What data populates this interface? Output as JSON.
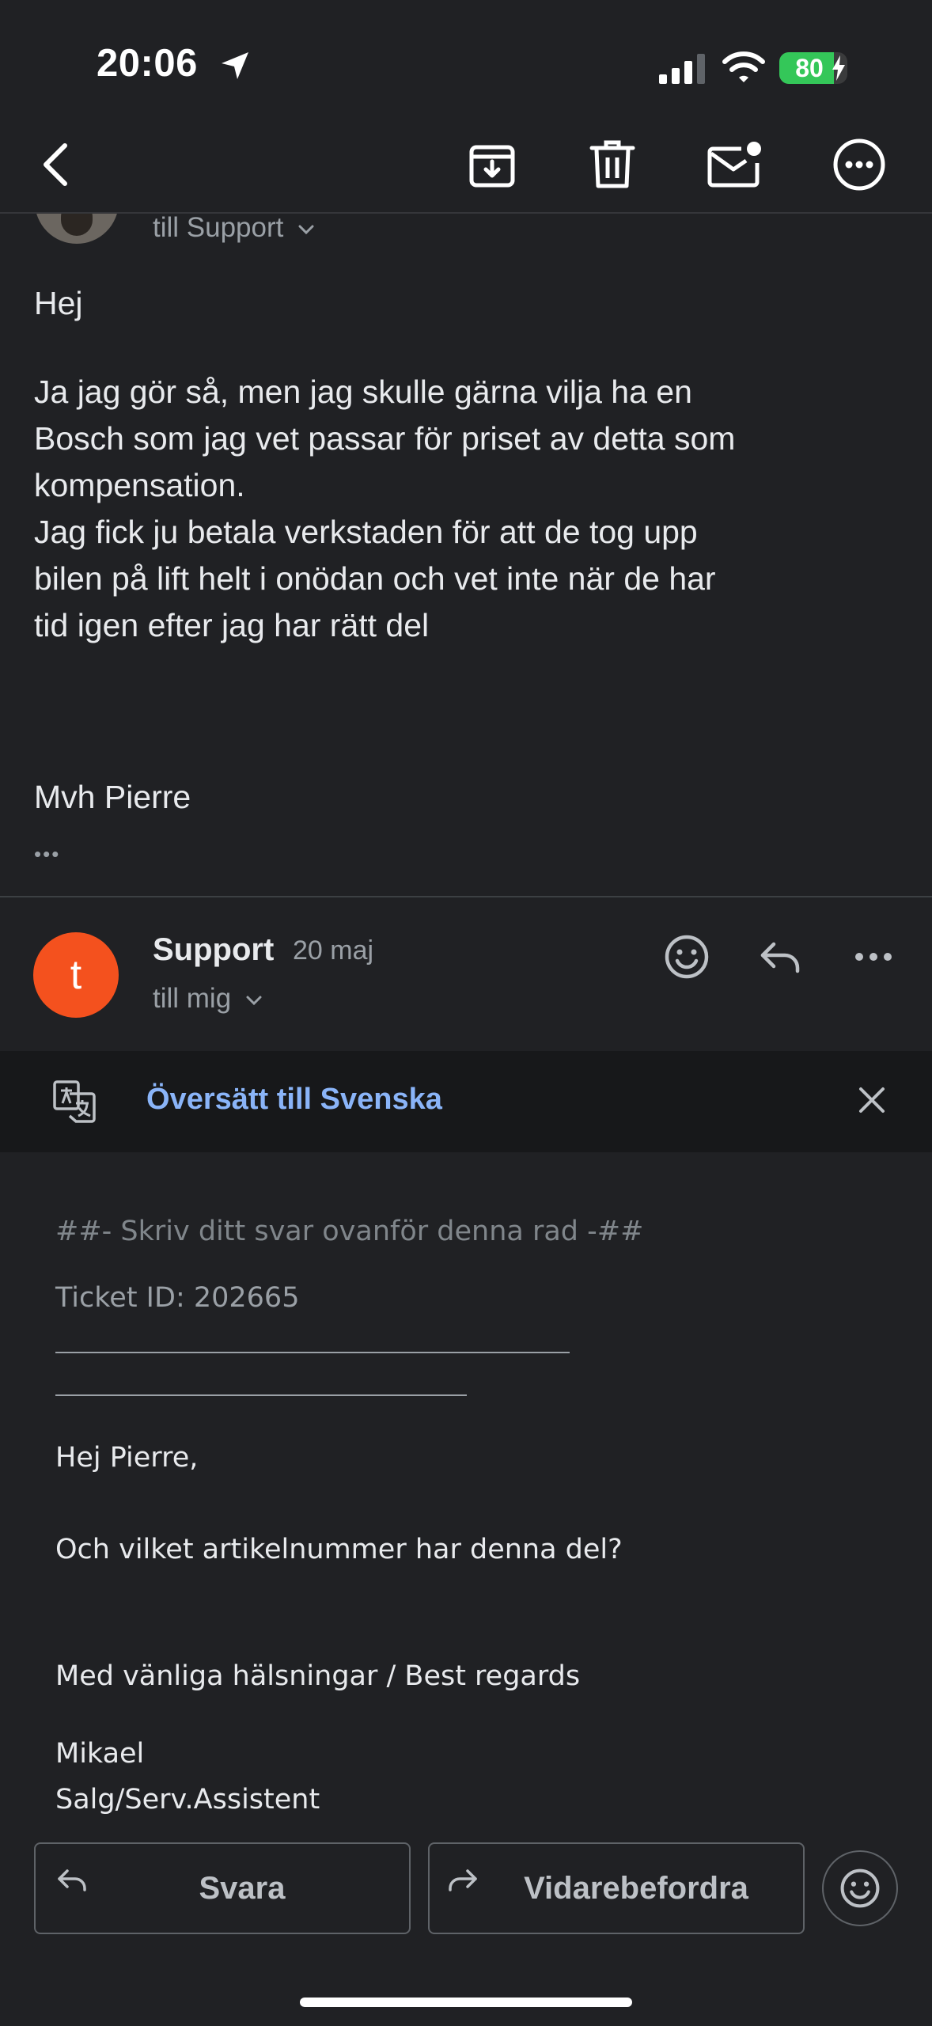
{
  "status_bar": {
    "time": "20:06",
    "battery": "80",
    "battery_level": 0.8
  },
  "toolbar": {
    "back": "back-icon",
    "archive": "archive-icon",
    "delete": "trash-icon",
    "mark_unread": "mail-unread-icon",
    "more": "more-icon"
  },
  "email_1": {
    "recipient": "till Support",
    "greeting": "Hej",
    "paragraph": [
      "Ja jag gör så, men jag skulle gärna vilja ha en",
      "Bosch som jag vet passar för priset av detta som",
      "kompensation.",
      "Jag fick ju betala verkstaden för att de tog upp",
      "bilen på lift helt i onödan och vet inte när de har",
      "tid igen efter jag har rätt del"
    ],
    "signature": "Mvh Pierre",
    "ellipsis": "•••"
  },
  "email_2": {
    "avatar_letter": "t",
    "avatar_color": "#f4511e",
    "sender": "Support",
    "date": "20 maj",
    "recipient": "till mig",
    "translate": "Översätt till Svenska",
    "reply_marker": "##- Skriv ditt svar ovanför denna rad -##",
    "ticket": "Ticket ID: 202665",
    "greeting": "Hej Pierre,",
    "question": "Och vilket artikelnummer har denna del?",
    "regards": "Med vänliga hälsningar / Best regards",
    "name": "Mikael",
    "title": "Salg/Serv.Assistent"
  },
  "actions": {
    "reply": "Svara",
    "forward": "Vidarebefordra"
  },
  "colors": {
    "background": "#202124",
    "link": "#8ab4f8",
    "accent_battery": "#34c759"
  }
}
